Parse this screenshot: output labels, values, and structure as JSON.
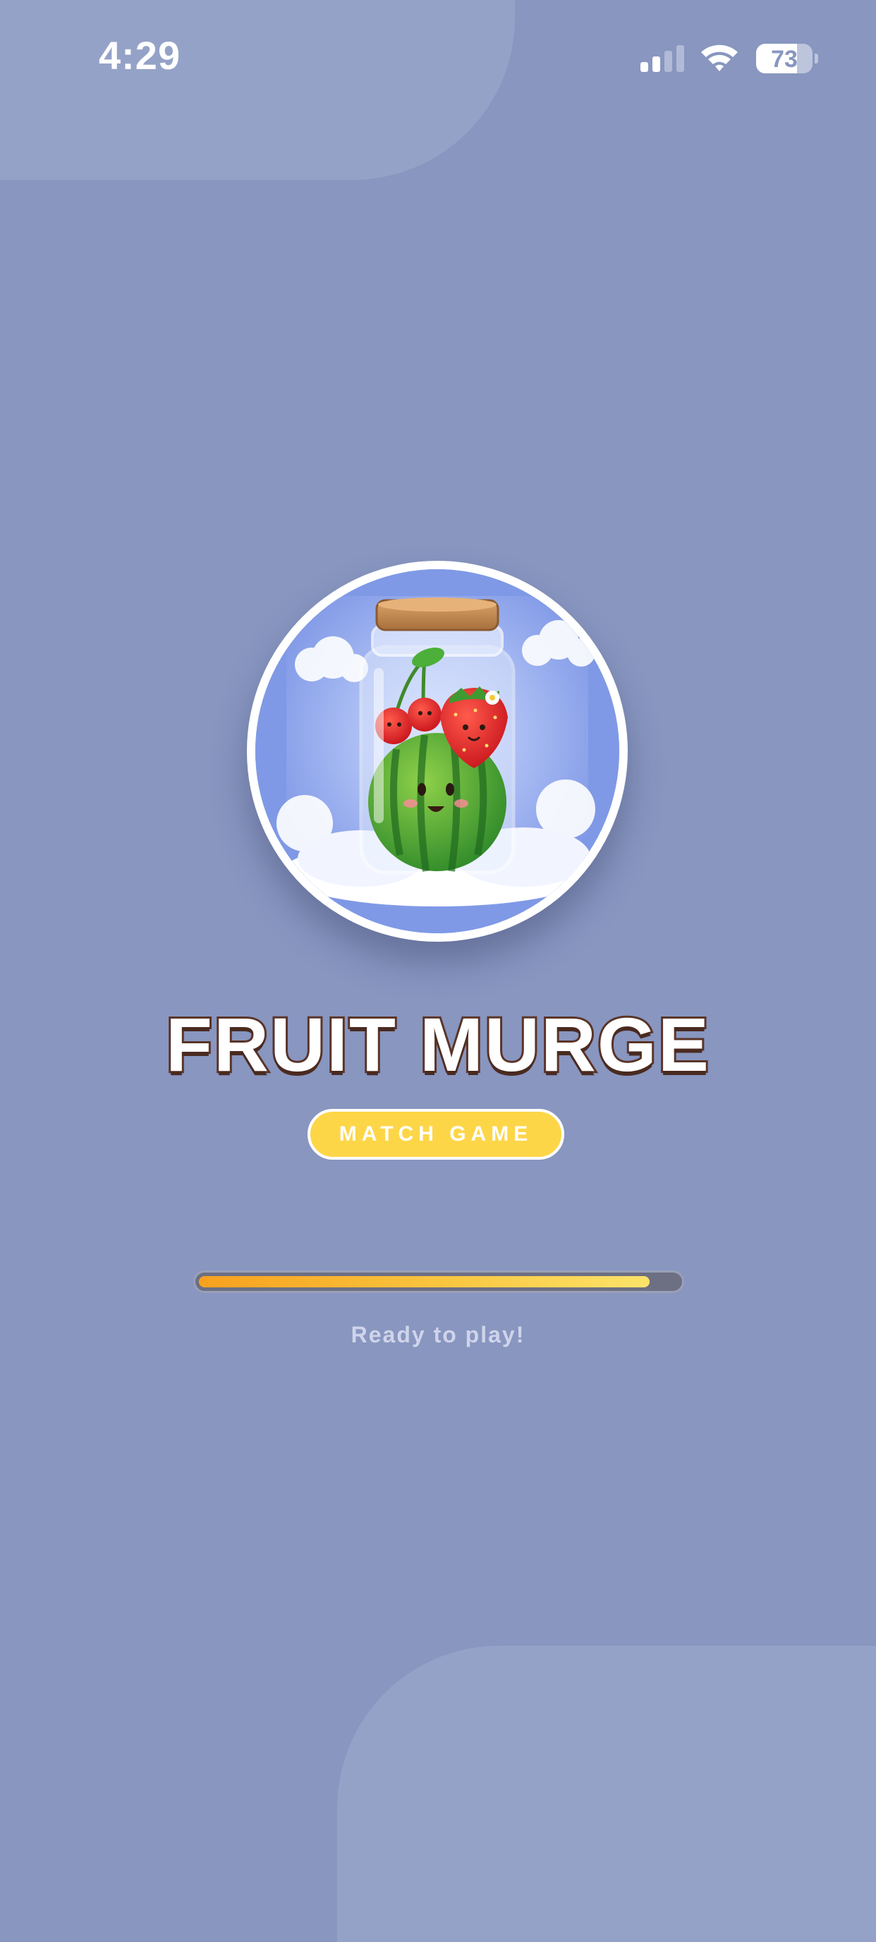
{
  "status_bar": {
    "time": "4:29",
    "battery": "73",
    "battery_level": 0.73,
    "signal_bars_active": 2,
    "signal_bars_total": 4
  },
  "logo": {
    "icon": "fruit-jar-logo-icon"
  },
  "game": {
    "title": "FRUIT MURGE",
    "subtitle": "MATCH GAME"
  },
  "loading": {
    "progress": 0.94,
    "message": "Ready to play!"
  },
  "colors": {
    "background": "#8896c0",
    "title_outline": "#5a3428",
    "badge": "#fdd648",
    "progress_start": "#f7a11e",
    "progress_end": "#fde36a"
  }
}
